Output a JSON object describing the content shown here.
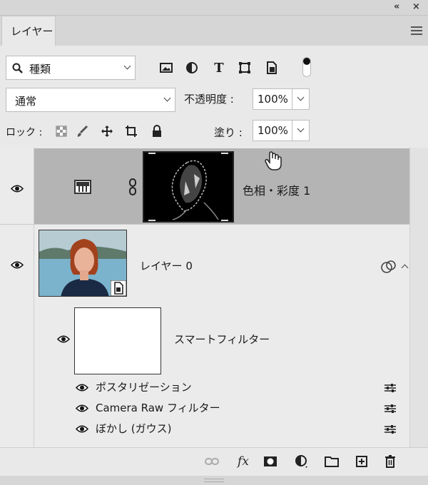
{
  "panel": {
    "tab_label": "レイヤー",
    "collapse_glyph": "«",
    "close_glyph": "×"
  },
  "filter": {
    "kind_label": "種類"
  },
  "blend": {
    "mode": "通常",
    "opacity_label": "不透明度 :",
    "opacity_value": "100%",
    "lock_label": "ロック :",
    "fill_label": "塗り :",
    "fill_value": "100%"
  },
  "layers": [
    {
      "name": "色相・彩度 1",
      "type": "adjustment",
      "selected": true
    },
    {
      "name": "レイヤー 0",
      "type": "smart-object",
      "selected": false
    }
  ],
  "smart_filters": {
    "label": "スマートフィルター",
    "items": [
      {
        "name": "ポスタリゼーション"
      },
      {
        "name": "Camera Raw フィルター"
      },
      {
        "name": "ぼかし (ガウス)"
      }
    ]
  },
  "bottom": {
    "fx_label": "fx"
  },
  "colors": {
    "panel_bg": "#e9e9e9",
    "selected_row": "#b4b4b4"
  }
}
